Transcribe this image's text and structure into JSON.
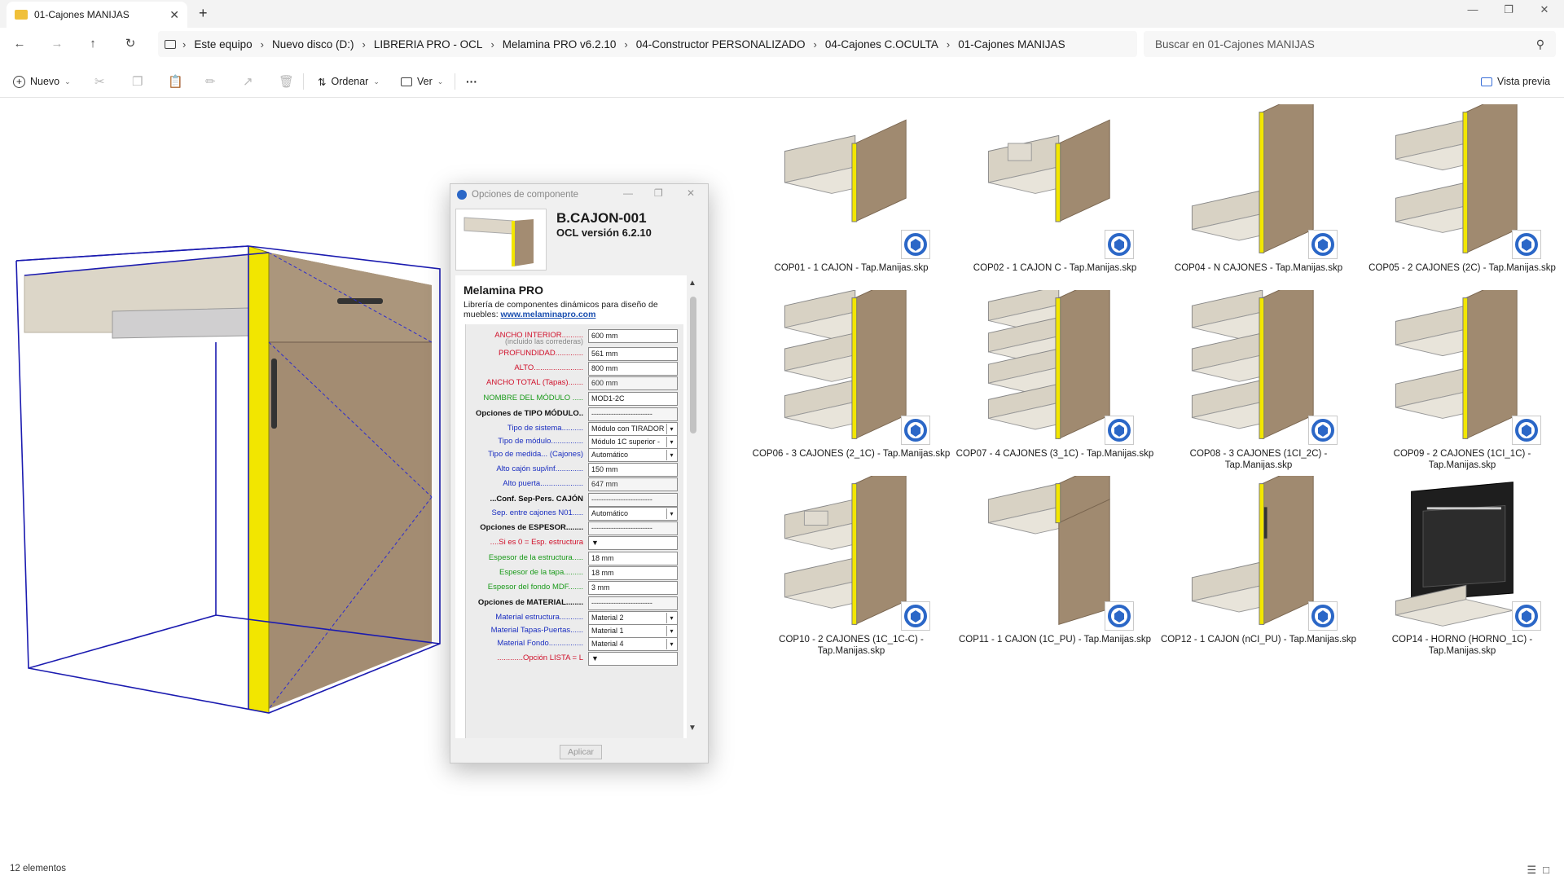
{
  "window": {
    "tab_title": "01-Cajones MANIJAS",
    "tab_close": "✕",
    "new_tab": "+",
    "controls": {
      "minimize": "—",
      "maximize": "❐",
      "close": "✕"
    }
  },
  "nav": {
    "back": "←",
    "forward": "→",
    "up": "↑",
    "refresh": "↻",
    "breadcrumbs": [
      "Este equipo",
      "Nuevo disco (D:)",
      "LIBRERIA PRO - OCL",
      "Melamina PRO v6.2.10",
      "04-Constructor PERSONALIZADO",
      "04-Cajones C.OCULTA",
      "01-Cajones MANIJAS"
    ],
    "separator": "›",
    "search_placeholder": "Buscar en 01-Cajones MANIJAS"
  },
  "toolbar": {
    "new_label": "Nuevo",
    "sort_label": "Ordenar",
    "view_label": "Ver",
    "more_label": "···",
    "preview_label": "Vista previa"
  },
  "dialog": {
    "title": "Opciones de componente",
    "component_name": "B.CAJON-001",
    "version": "OCL versión 6.2.10",
    "brand_title": "Melamina PRO",
    "description": "Librería de componentes dinámicos para diseño de muebles:",
    "link": "www.melaminapro.com",
    "apply_label": "Aplicar",
    "fields": [
      {
        "label": "ANCHO INTERIOR..........",
        "sub": "(incluido las correderas)",
        "value": "600 mm",
        "color": "red",
        "kind": "text"
      },
      {
        "label": "PROFUNDIDAD.............",
        "value": "561 mm",
        "color": "red",
        "kind": "text"
      },
      {
        "label": "ALTO.......................",
        "value": "800 mm",
        "color": "red",
        "kind": "text"
      },
      {
        "label": "ANCHO TOTAL (Tapas).......",
        "value": "600 mm",
        "color": "red",
        "kind": "ro"
      },
      {
        "label": "NOMBRE DEL MÓDULO .....",
        "value": "MOD1-2C",
        "color": "green",
        "kind": "text"
      },
      {
        "label": "Opciones de TIPO MÓDULO..",
        "value": "-------------------------",
        "color": "black",
        "kind": "ro"
      },
      {
        "label": "Tipo de sistema..........",
        "value": "Módulo con TIRADOR",
        "color": "blue",
        "kind": "sel"
      },
      {
        "label": "Tipo de módulo...............",
        "value": "Módulo 1C superior -",
        "color": "blue",
        "kind": "sel"
      },
      {
        "label": "Tipo de medida... (Cajones)",
        "value": "Automático",
        "color": "blue",
        "kind": "sel"
      },
      {
        "label": "Alto cajón sup/inf.............",
        "value": "150 mm",
        "color": "blue",
        "kind": "text"
      },
      {
        "label": "Alto puerta....................",
        "value": "647 mm",
        "color": "blue",
        "kind": "ro"
      },
      {
        "label": "...Conf. Sep-Pers. CAJÓN",
        "value": "-------------------------",
        "color": "black",
        "kind": "ro"
      },
      {
        "label": "Sep. entre cajones N01.....",
        "value": "Automático",
        "color": "blue",
        "kind": "sel"
      },
      {
        "label": "Opciones de ESPESOR........",
        "value": "-------------------------",
        "color": "black",
        "kind": "ro"
      },
      {
        "label": "....Si es 0 = Esp. estructura",
        "value": "▼",
        "color": "red",
        "kind": "text"
      },
      {
        "label": "Espesor de la estructura.....",
        "value": "18 mm",
        "color": "green",
        "kind": "text"
      },
      {
        "label": "Espesor de la tapa.........",
        "value": "18 mm",
        "color": "green",
        "kind": "text"
      },
      {
        "label": "Espesor del fondo MDF.......",
        "value": "3 mm",
        "color": "green",
        "kind": "text"
      },
      {
        "label": "Opciones de MATERIAL........",
        "value": "-------------------------",
        "color": "black",
        "kind": "ro"
      },
      {
        "label": "Material estructura...........",
        "value": "Material 2",
        "color": "blue",
        "kind": "sel"
      },
      {
        "label": "Material Tapas-Puertas......",
        "value": "Material 1",
        "color": "blue",
        "kind": "sel"
      },
      {
        "label": "Material Fondo................",
        "value": "Material 4",
        "color": "blue",
        "kind": "sel"
      },
      {
        "label": "............Opción LISTA = L",
        "value": "▼",
        "color": "red",
        "kind": "text"
      }
    ]
  },
  "files": [
    {
      "name": "COP01 - 1 CAJON - Tap.Manijas.skp",
      "thumb": "drawer-1"
    },
    {
      "name": "COP02 - 1 CAJON C - Tap.Manijas.skp",
      "thumb": "drawer-1c"
    },
    {
      "name": "COP04 - N CAJONES - Tap.Manijas.skp",
      "thumb": "n-drawers"
    },
    {
      "name": "COP05 - 2 CAJONES (2C) - Tap.Manijas.skp",
      "thumb": "drawers-2"
    },
    {
      "name": "COP06 - 3 CAJONES (2_1C) - Tap.Manijas.skp",
      "thumb": "drawers-3"
    },
    {
      "name": "COP07 - 4 CAJONES (3_1C) - Tap.Manijas.skp",
      "thumb": "drawers-4"
    },
    {
      "name": "COP08 - 3 CAJONES (1CI_2C) - Tap.Manijas.skp",
      "thumb": "drawers-3"
    },
    {
      "name": "COP09 - 2 CAJONES (1CI_1C) - Tap.Manijas.skp",
      "thumb": "drawers-2"
    },
    {
      "name": "COP10 - 2 CAJONES (1C_1C-C) - Tap.Manijas.skp",
      "thumb": "drawers-2c"
    },
    {
      "name": "COP11 - 1 CAJON (1C_PU) - Tap.Manijas.skp",
      "thumb": "drawer-door"
    },
    {
      "name": "COP12 - 1 CAJON (nCI_PU) - Tap.Manijas.skp",
      "thumb": "drawer-door-low"
    },
    {
      "name": "COP14 - HORNO (HORNO_1C) - Tap.Manijas.skp",
      "thumb": "oven"
    }
  ],
  "status": {
    "count": "12 elementos"
  },
  "colors": {
    "wood": "#a08a70",
    "drawer": "#d8d2c4",
    "edge": "#f2e600",
    "wire": "#1b1bb0"
  }
}
